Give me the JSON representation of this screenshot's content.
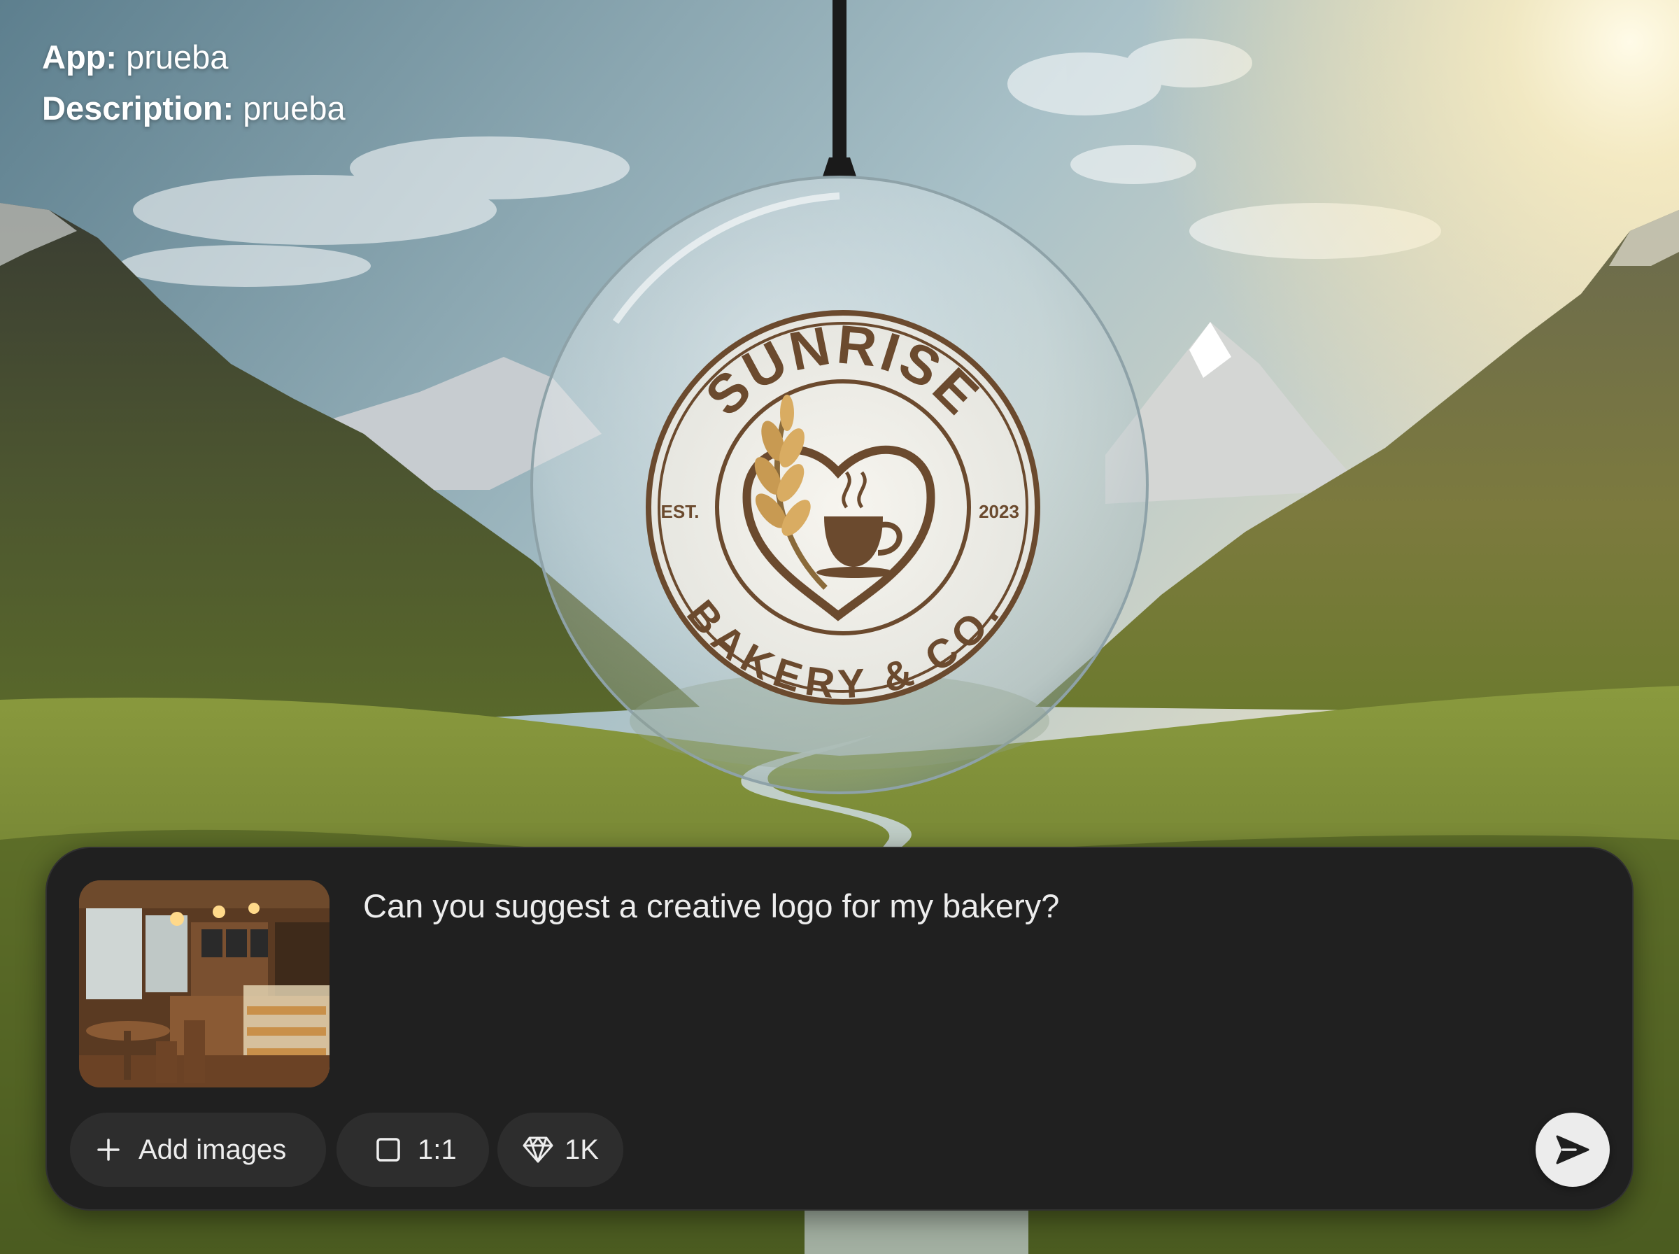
{
  "header": {
    "app_label": "App:",
    "app_value": "prueba",
    "description_label": "Description:",
    "description_value": "prueba"
  },
  "generated_image": {
    "logo": {
      "top_text": "SUNRISE",
      "bottom_text": "BAKERY & CO.",
      "left_text": "EST.",
      "right_text": "2023"
    },
    "logo_color": "#6b4a2e"
  },
  "composer": {
    "prompt_text": "Can you suggest a creative logo for my bakery?",
    "attached_image_icon": "bakery-interior-photo",
    "add_images_label": "Add images",
    "aspect_label": "1:1",
    "quality_label": "1K",
    "icons": {
      "add": "plus-icon",
      "aspect": "square-icon",
      "quality": "diamond-icon",
      "send": "send-arrow-icon"
    }
  },
  "colors": {
    "panel_bg": "#202020",
    "pill_bg": "#2d2d2d",
    "send_bg": "#ececec",
    "text": "#ededed"
  }
}
